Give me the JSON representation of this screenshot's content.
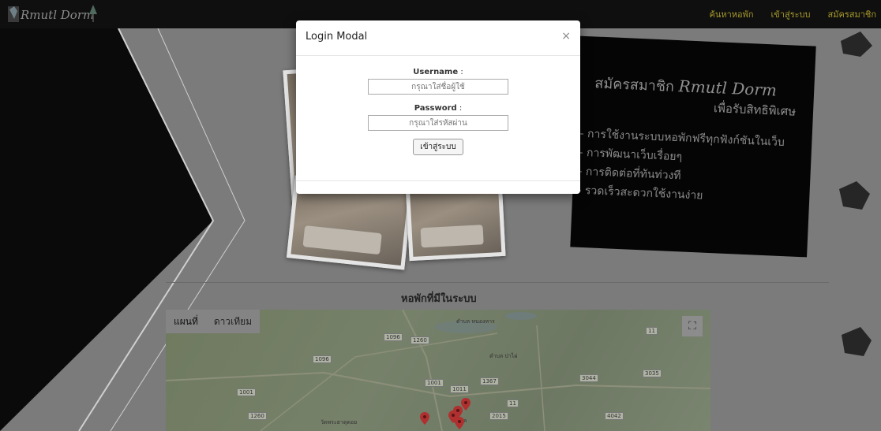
{
  "brand": {
    "name": "Rmutl Dorm"
  },
  "nav": {
    "items": [
      {
        "label": "ค้นหาหอพัก"
      },
      {
        "label": "เข้าสู่ระบบ"
      },
      {
        "label": "สมัครสมาชิก"
      }
    ]
  },
  "promo": {
    "title_prefix": "สมัครสมาชิก",
    "title_script": "Rmutl Dorm",
    "subtitle": "เพื่อรับสิทธิพิเศษ",
    "benefits": [
      "- การใช้งานระบบหอพักฟรีทุกฟังก์ชันในเว็บ",
      "- การพัฒนาเว็บเรื่อยๆ",
      "- การติดต่อที่ทันท่วงที",
      "- รวดเร็วสะดวกใช้งานง่าย"
    ]
  },
  "map_section": {
    "title": "หอพักที่มีในระบบ",
    "map_type_buttons": [
      "แผนที่",
      "ดาวเทียม"
    ],
    "road_labels": [
      "1096",
      "1260",
      "1096",
      "1011",
      "1367",
      "1001",
      "11",
      "1001",
      "3035",
      "3044",
      "1260",
      "4042",
      "2015",
      "11"
    ],
    "place_labels": [
      "ตำบล หนองหาร",
      "ตำบล ป่าไผ่",
      "ตำบล",
      "วัดพระธาตุดอย"
    ]
  },
  "modal": {
    "title": "Login Modal",
    "close_glyph": "×",
    "username_label": "Username",
    "username_placeholder": "กรุณาใส่ชื่อผู้ใช้",
    "password_label": "Password",
    "password_placeholder": "กรุณาใส่รหัสผ่าน",
    "submit_label": "เข้าสู่ระบบ"
  },
  "colors": {
    "nav_link": "#a79a2a",
    "navbar_bg": "#0f0f0f",
    "backdrop": "#7b7b7b",
    "pin": "#b03030"
  }
}
